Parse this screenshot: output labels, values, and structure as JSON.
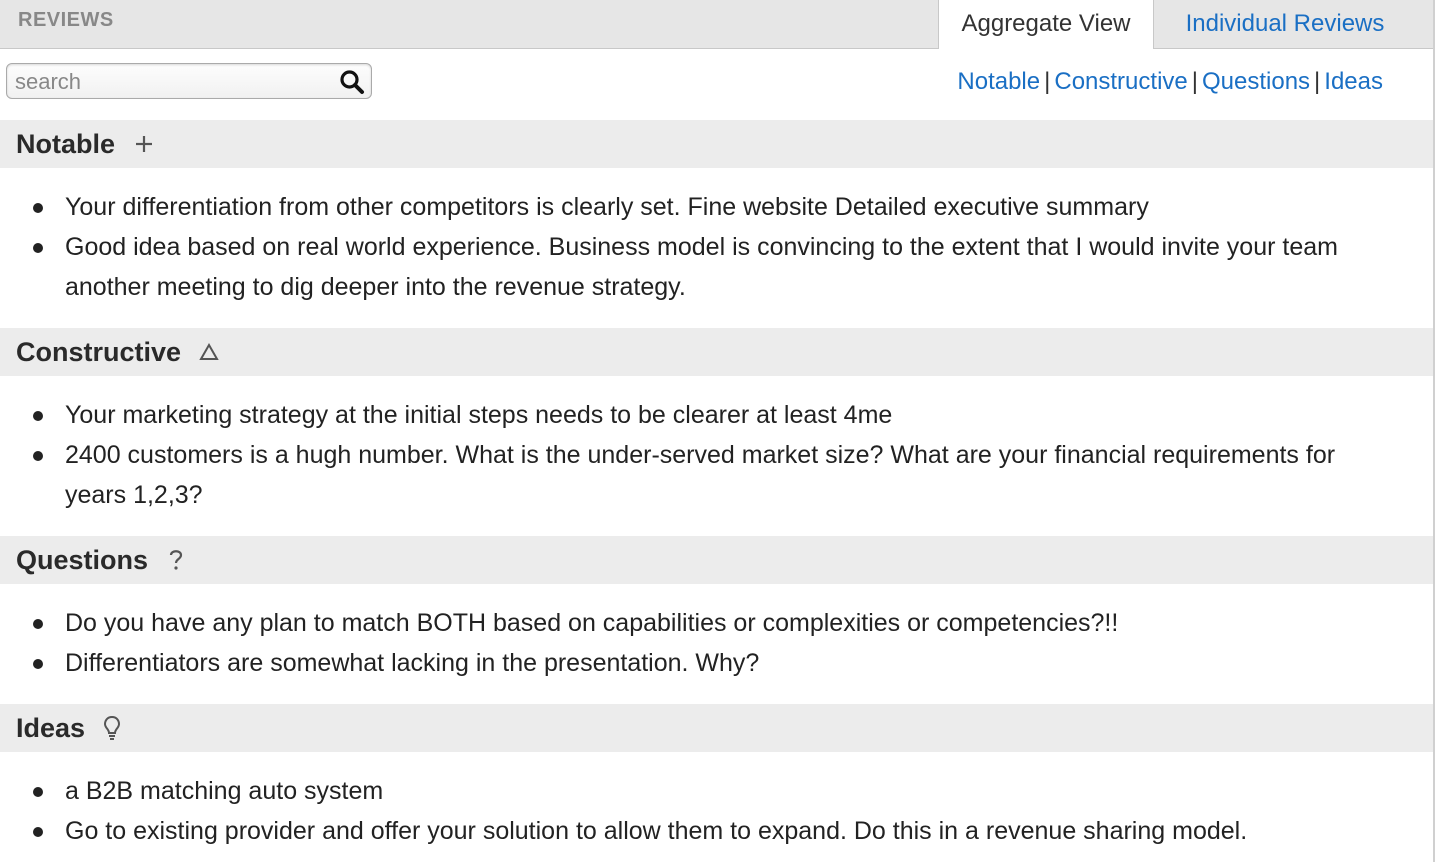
{
  "header": {
    "title": "REVIEWS",
    "tabs": [
      {
        "label": "Aggregate View",
        "active": true
      },
      {
        "label": "Individual Reviews",
        "active": false
      }
    ]
  },
  "search": {
    "placeholder": "search",
    "value": ""
  },
  "filters": [
    "Notable",
    "Constructive",
    "Questions",
    "Ideas"
  ],
  "sections": {
    "notable": {
      "title": "Notable",
      "icon": "plus-icon",
      "items": [
        "Your differentiation from other competitors is clearly set. Fine website Detailed executive summary",
        "Good idea based on real world experience.  Business model is convincing to the extent that I would invite your team another meeting to dig deeper into the revenue strategy."
      ]
    },
    "constructive": {
      "title": "Constructive",
      "icon": "delta-icon",
      "items": [
        "Your marketing strategy at the initial steps needs to be clearer at least 4me",
        "2400 customers is a hugh number.  What is the under-served market size?  What are your financial requirements for years 1,2,3?"
      ]
    },
    "questions": {
      "title": "Questions",
      "icon": "question-icon",
      "items": [
        "Do you have any plan to match BOTH based on capabilities or complexities or competencies?!!",
        "Differentiators are somewhat lacking in the presentation. Why?"
      ]
    },
    "ideas": {
      "title": "Ideas",
      "icon": "lightbulb-icon",
      "items": [
        "a B2B matching auto system",
        "Go to existing provider and offer your solution to allow them to expand. Do this in a revenue sharing model."
      ]
    }
  },
  "colors": {
    "link": "#1a6fc4",
    "section_bg": "#ececec",
    "topbar_bg": "#e6e6e6"
  }
}
